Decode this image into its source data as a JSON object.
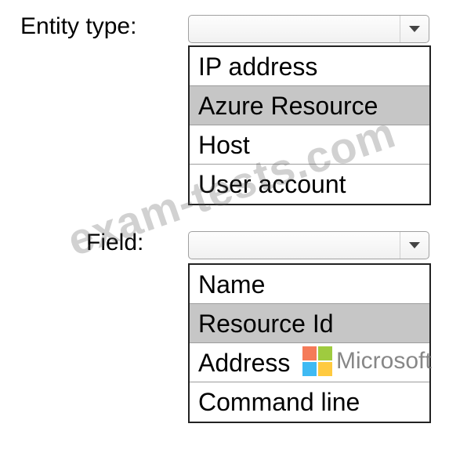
{
  "entity": {
    "label": "Entity type:",
    "selected_value": "",
    "options": [
      "IP address",
      "Azure Resource",
      "Host",
      "User account"
    ]
  },
  "field": {
    "label": "Field:",
    "selected_value": "",
    "options": [
      "Name",
      "Resource Id",
      "Address",
      "Command line"
    ]
  },
  "overlay": {
    "watermark": "exam-tests.com",
    "brand": "Microsoft"
  },
  "colors": {
    "highlight": "#c6c6c6",
    "border": "#222222",
    "logo_red": "#f25022",
    "logo_green": "#7fba00",
    "logo_blue": "#00a4ef",
    "logo_yellow": "#ffb900"
  },
  "icons": {
    "dropdown": "chevron-down-icon"
  }
}
